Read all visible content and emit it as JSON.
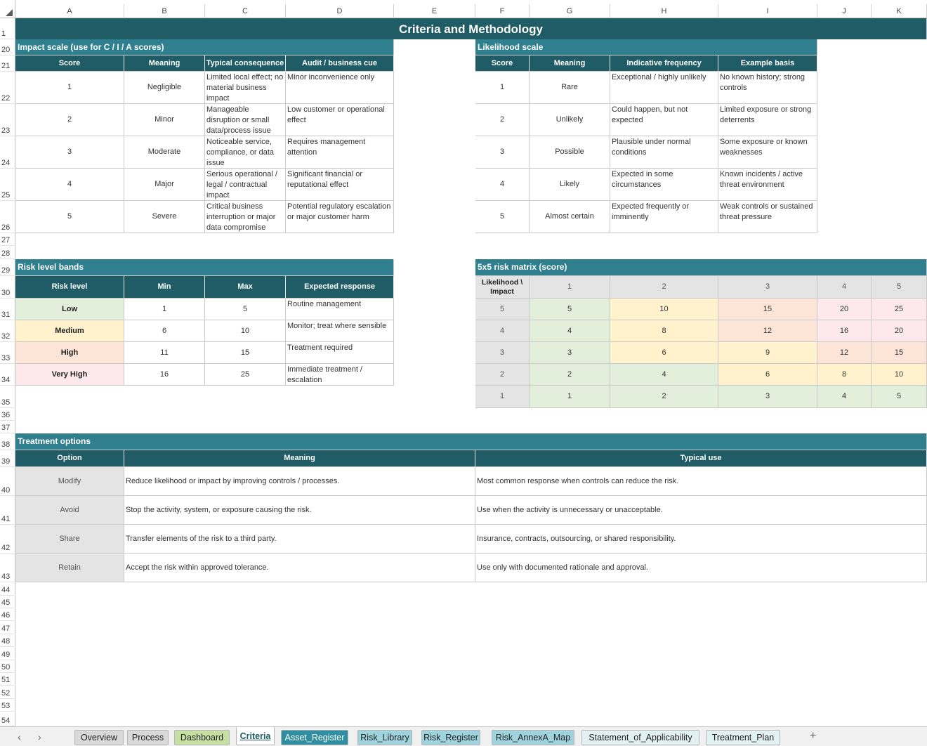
{
  "columns": [
    "A",
    "B",
    "C",
    "D",
    "E",
    "F",
    "G",
    "H",
    "I",
    "J",
    "K"
  ],
  "rows": [
    "1",
    "20",
    "21",
    "22",
    "23",
    "24",
    "25",
    "26",
    "27",
    "28",
    "29",
    "30",
    "31",
    "32",
    "33",
    "34",
    "35",
    "36",
    "37",
    "38",
    "39",
    "40",
    "41",
    "42",
    "43",
    "44",
    "45",
    "46",
    "47",
    "48",
    "49",
    "50",
    "51",
    "52",
    "53",
    "54"
  ],
  "title": "Criteria and Methodology",
  "impact": {
    "title": "Impact scale (use for C / I / A scores)",
    "headers": [
      "Score",
      "Meaning",
      "Typical consequence",
      "Audit / business cue"
    ],
    "rows": [
      [
        "1",
        "Negligible",
        "Limited local effect; no material business impact",
        "Minor inconvenience only"
      ],
      [
        "2",
        "Minor",
        "Manageable disruption or small data/process issue",
        "Low customer or operational effect"
      ],
      [
        "3",
        "Moderate",
        "Noticeable service, compliance, or data issue",
        "Requires management attention"
      ],
      [
        "4",
        "Major",
        "Serious operational / legal / contractual impact",
        "Significant financial or reputational effect"
      ],
      [
        "5",
        "Severe",
        "Critical business interruption or major data compromise",
        "Potential regulatory escalation or major customer harm"
      ]
    ]
  },
  "likelihood": {
    "title": "Likelihood scale",
    "headers": [
      "Score",
      "Meaning",
      "Indicative frequency",
      "Example basis"
    ],
    "rows": [
      [
        "1",
        "Rare",
        "Exceptional / highly unlikely",
        "No known history; strong controls"
      ],
      [
        "2",
        "Unlikely",
        "Could happen, but not expected",
        "Limited exposure or strong deterrents"
      ],
      [
        "3",
        "Possible",
        "Plausible under normal conditions",
        "Some exposure or known weaknesses"
      ],
      [
        "4",
        "Likely",
        "Expected in some circumstances",
        "Known incidents / active threat environment"
      ],
      [
        "5",
        "Almost certain",
        "Expected frequently or imminently",
        "Weak controls or sustained threat pressure"
      ]
    ]
  },
  "bands": {
    "title": "Risk level bands",
    "headers": [
      "Risk level",
      "Min",
      "Max",
      "Expected response"
    ],
    "rows": [
      [
        "Low",
        "1",
        "5",
        "Routine management"
      ],
      [
        "Medium",
        "6",
        "10",
        "Monitor; treat where sensible"
      ],
      [
        "High",
        "11",
        "15",
        "Treatment required"
      ],
      [
        "Very High",
        "16",
        "25",
        "Immediate treatment / escalation"
      ]
    ]
  },
  "matrix": {
    "title": "5x5 risk matrix (score)",
    "corner": "Likelihood \\ Impact",
    "cols": [
      "1",
      "2",
      "3",
      "4",
      "5"
    ],
    "rows": [
      {
        "impact": "5",
        "vals": [
          "5",
          "10",
          "15",
          "20",
          "25"
        ]
      },
      {
        "impact": "4",
        "vals": [
          "4",
          "8",
          "12",
          "16",
          "20"
        ]
      },
      {
        "impact": "3",
        "vals": [
          "3",
          "6",
          "9",
          "12",
          "15"
        ]
      },
      {
        "impact": "2",
        "vals": [
          "2",
          "4",
          "6",
          "8",
          "10"
        ]
      },
      {
        "impact": "1",
        "vals": [
          "1",
          "2",
          "3",
          "4",
          "5"
        ]
      }
    ]
  },
  "treatment": {
    "title": "Treatment options",
    "headers": [
      "Option",
      "Meaning",
      "Typical use"
    ],
    "rows": [
      [
        "Modify",
        "Reduce likelihood or impact by improving controls / processes.",
        "Most common response when controls can reduce the risk."
      ],
      [
        "Avoid",
        "Stop the activity, system, or exposure causing the risk.",
        "Use when the activity is unnecessary or unacceptable."
      ],
      [
        "Share",
        "Transfer elements of the risk to a third party.",
        "Insurance, contracts, outsourcing, or shared responsibility."
      ],
      [
        "Retain",
        "Accept the risk within approved tolerance.",
        "Use only with documented rationale and approval."
      ]
    ]
  },
  "tabs": [
    {
      "label": "Overview",
      "color": "#d9d9d9"
    },
    {
      "label": "Process",
      "color": "#d9d9d9"
    },
    {
      "label": "Dashboard",
      "color": "#c6e0a4"
    },
    {
      "label": "Criteria",
      "color": "#ffffff"
    },
    {
      "label": "Asset_Register",
      "color": "#2f8fa0"
    },
    {
      "label": "Risk_Library",
      "color": "#9fd3dd"
    },
    {
      "label": "Risk_Register",
      "color": "#9fd3dd"
    },
    {
      "label": "Risk_AnnexA_Map",
      "color": "#9fd3dd"
    },
    {
      "label": "Statement_of_Applicability",
      "color": "#e2f1f4"
    },
    {
      "label": "Treatment_Plan",
      "color": "#e2f1f4"
    }
  ],
  "nav": {
    "prev": "‹",
    "next": "›",
    "add": "+"
  }
}
